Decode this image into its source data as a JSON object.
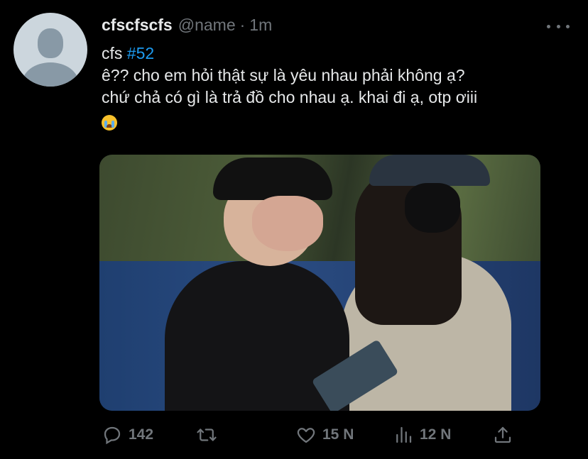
{
  "tweet": {
    "display_name": "cfscfscfs",
    "handle": "@name",
    "separator": "·",
    "time": "1m",
    "text_prefix": "cfs ",
    "hashtag": "#52",
    "line2": "ê?? cho em hỏi thật sự là yêu nhau phải không ạ?",
    "line3": "chứ chả có gì là trả đồ cho nhau ạ. khai đi ạ, otp ơiii",
    "emoji_icon": "loudly-crying-face-icon",
    "colors": {
      "background": "#000000",
      "text": "#e7e9ea",
      "muted": "#71767b",
      "accent": "#1d9bf0"
    }
  },
  "actions": {
    "reply_count": "142",
    "retweet_count": "",
    "like_count": "15 N",
    "views_count": "12 N",
    "icons": [
      "reply-icon",
      "retweet-icon",
      "like-icon",
      "views-icon",
      "share-icon"
    ]
  }
}
